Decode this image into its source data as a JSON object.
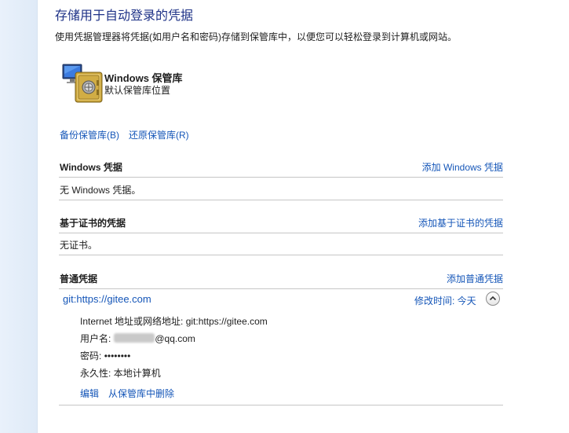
{
  "header": {
    "title": "存储用于自动登录的凭据",
    "description": "使用凭据管理器将凭据(如用户名和密码)存储到保管库中，以便您可以轻松登录到计算机或网站。"
  },
  "vault": {
    "name": "Windows 保管库",
    "location": "默认保管库位置",
    "icon": "vault-safe-icon"
  },
  "actions": {
    "backup": "备份保管库(B)",
    "restore": "还原保管库(R)"
  },
  "sections": {
    "windows": {
      "title": "Windows 凭据",
      "add_link": "添加 Windows 凭据",
      "empty_text": "无 Windows 凭据。"
    },
    "certificate": {
      "title": "基于证书的凭据",
      "add_link": "添加基于证书的凭据",
      "empty_text": "无证书。"
    },
    "generic": {
      "title": "普通凭据",
      "add_link": "添加普通凭据",
      "credential": {
        "name": "git:https://gitee.com",
        "modified": "修改时间: 今天",
        "internet_address_label": "Internet 地址或网络地址:",
        "internet_address_value": "git:https://gitee.com",
        "username_label": "用户名:",
        "username_value": "@qq.com",
        "password_label": "密码:",
        "password_value": "••••••••",
        "persistence_label": "永久性:",
        "persistence_value": "本地计算机",
        "edit_link": "编辑",
        "remove_link": "从保管库中删除"
      }
    }
  }
}
